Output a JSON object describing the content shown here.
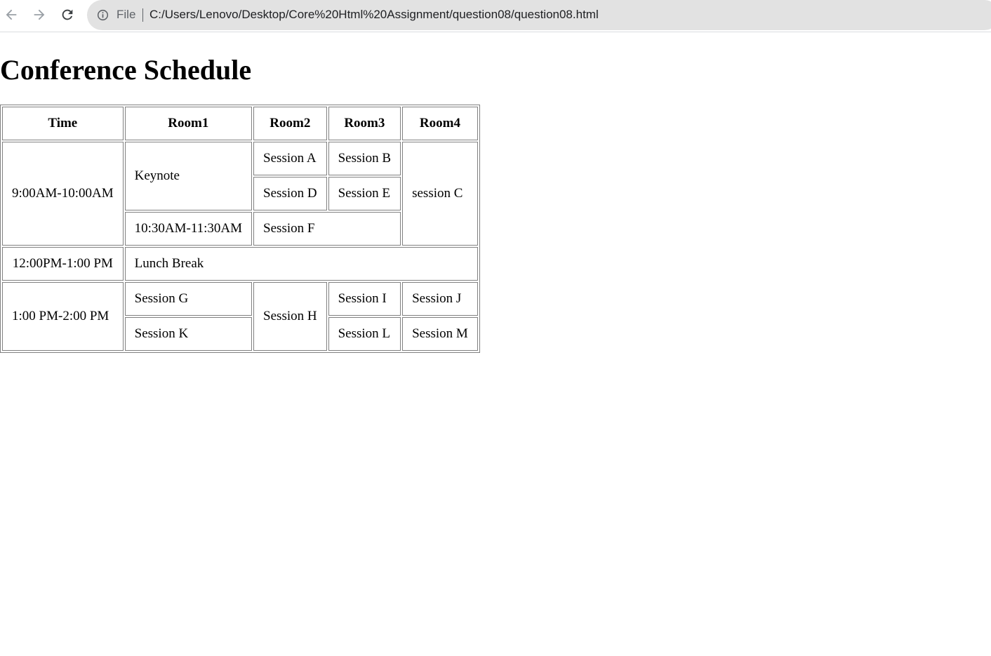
{
  "browser": {
    "scheme_label": "File",
    "url": "C:/Users/Lenovo/Desktop/Core%20Html%20Assignment/question08/question08.html"
  },
  "page": {
    "heading": "Conference Schedule"
  },
  "table": {
    "headers": [
      "Time",
      "Room1",
      "Room2",
      "Room3",
      "Room4"
    ],
    "row1": {
      "time": "9:00AM-10:00AM",
      "room1": "Keynote",
      "room2": "Session A",
      "room3": "Session B",
      "room4": "session C"
    },
    "row2": {
      "room2": "Session D",
      "room3": "Session E"
    },
    "row3": {
      "room1": "10:30AM-11:30AM",
      "room23": "Session F"
    },
    "row4": {
      "time": "12:00PM-1:00 PM",
      "all_rooms": "Lunch Break"
    },
    "row5": {
      "time": "1:00 PM-2:00 PM",
      "room1": "Session G",
      "room2": "Session H",
      "room3": "Session I",
      "room4": "Session J"
    },
    "row6": {
      "room1": "Session K",
      "room3": "Session L",
      "room4": "Session M"
    }
  }
}
